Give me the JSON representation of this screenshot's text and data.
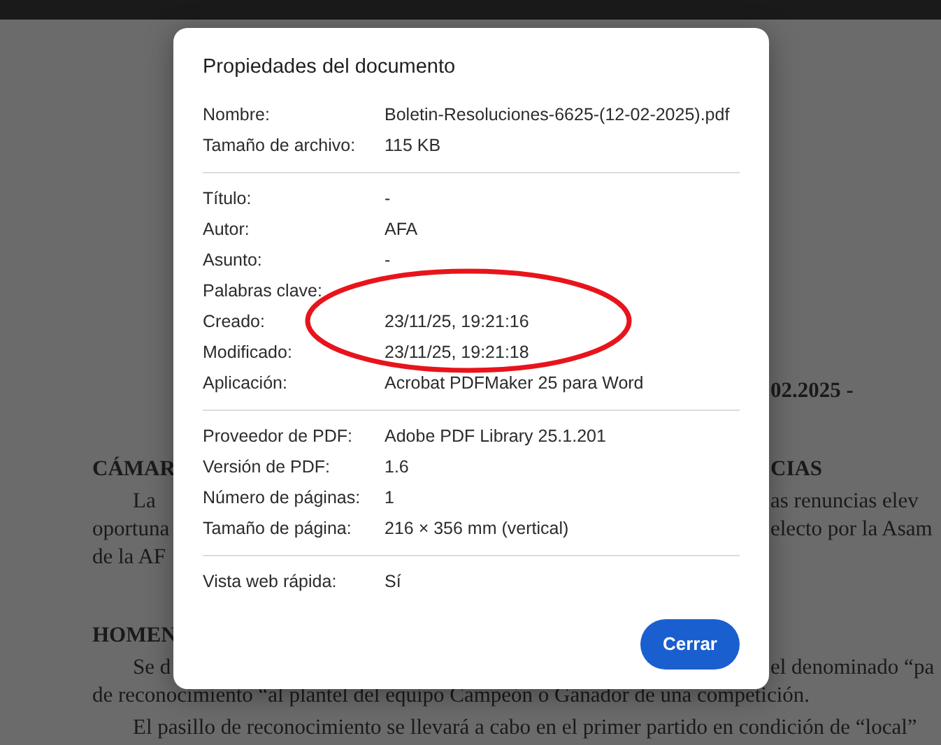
{
  "document": {
    "lines": [
      {
        "kind": "date",
        "right": "02.2025 -"
      },
      {
        "kind": "heading",
        "left": "CÁMAR",
        "right": "CIAS"
      },
      {
        "kind": "para-start",
        "left": "La",
        "right": "as renuncias elev"
      },
      {
        "kind": "line",
        "left": "oportuna",
        "right": "electo por la Asam"
      },
      {
        "kind": "line",
        "left": "de la AF"
      },
      {
        "kind": "heading",
        "left": "HOMEN"
      },
      {
        "kind": "para-start",
        "left": "Se d",
        "right": "el denominado “pa"
      },
      {
        "kind": "line",
        "full": "de reconocimiento “al plantel del equipo Campeón o Ganador de una competición."
      },
      {
        "kind": "para-start",
        "full": "El pasillo de reconocimiento se llevará a cabo en el primer partido en condición de “local”"
      }
    ]
  },
  "dialog": {
    "title": "Propiedades del documento",
    "sections": [
      [
        {
          "label": "Nombre:",
          "value": "Boletin-Resoluciones-6625-(12-02-2025).pdf"
        },
        {
          "label": "Tamaño de archivo:",
          "value": "115 KB"
        }
      ],
      [
        {
          "label": "Título:",
          "value": "-"
        },
        {
          "label": "Autor:",
          "value": "AFA"
        },
        {
          "label": "Asunto:",
          "value": "-"
        },
        {
          "label": "Palabras clave:"
        },
        {
          "label": "Creado:",
          "value": "23/11/25, 19:21:16"
        },
        {
          "label": "Modificado:",
          "value": "23/11/25, 19:21:18"
        },
        {
          "label": "Aplicación:",
          "value": "Acrobat PDFMaker 25 para Word"
        }
      ],
      [
        {
          "label": "Proveedor de PDF:",
          "value": "Adobe PDF Library 25.1.201"
        },
        {
          "label": "Versión de PDF:",
          "value": "1.6"
        },
        {
          "label": "Número de páginas:",
          "value": "1"
        },
        {
          "label": "Tamaño de página:",
          "value": "216 × 356 mm (vertical)"
        }
      ],
      [
        {
          "label": "Vista web rápida:",
          "value": "Sí"
        }
      ]
    ],
    "button": "Cerrar"
  },
  "annotations": [
    {
      "kind": "ellipse",
      "color": "#e8141c"
    }
  ]
}
